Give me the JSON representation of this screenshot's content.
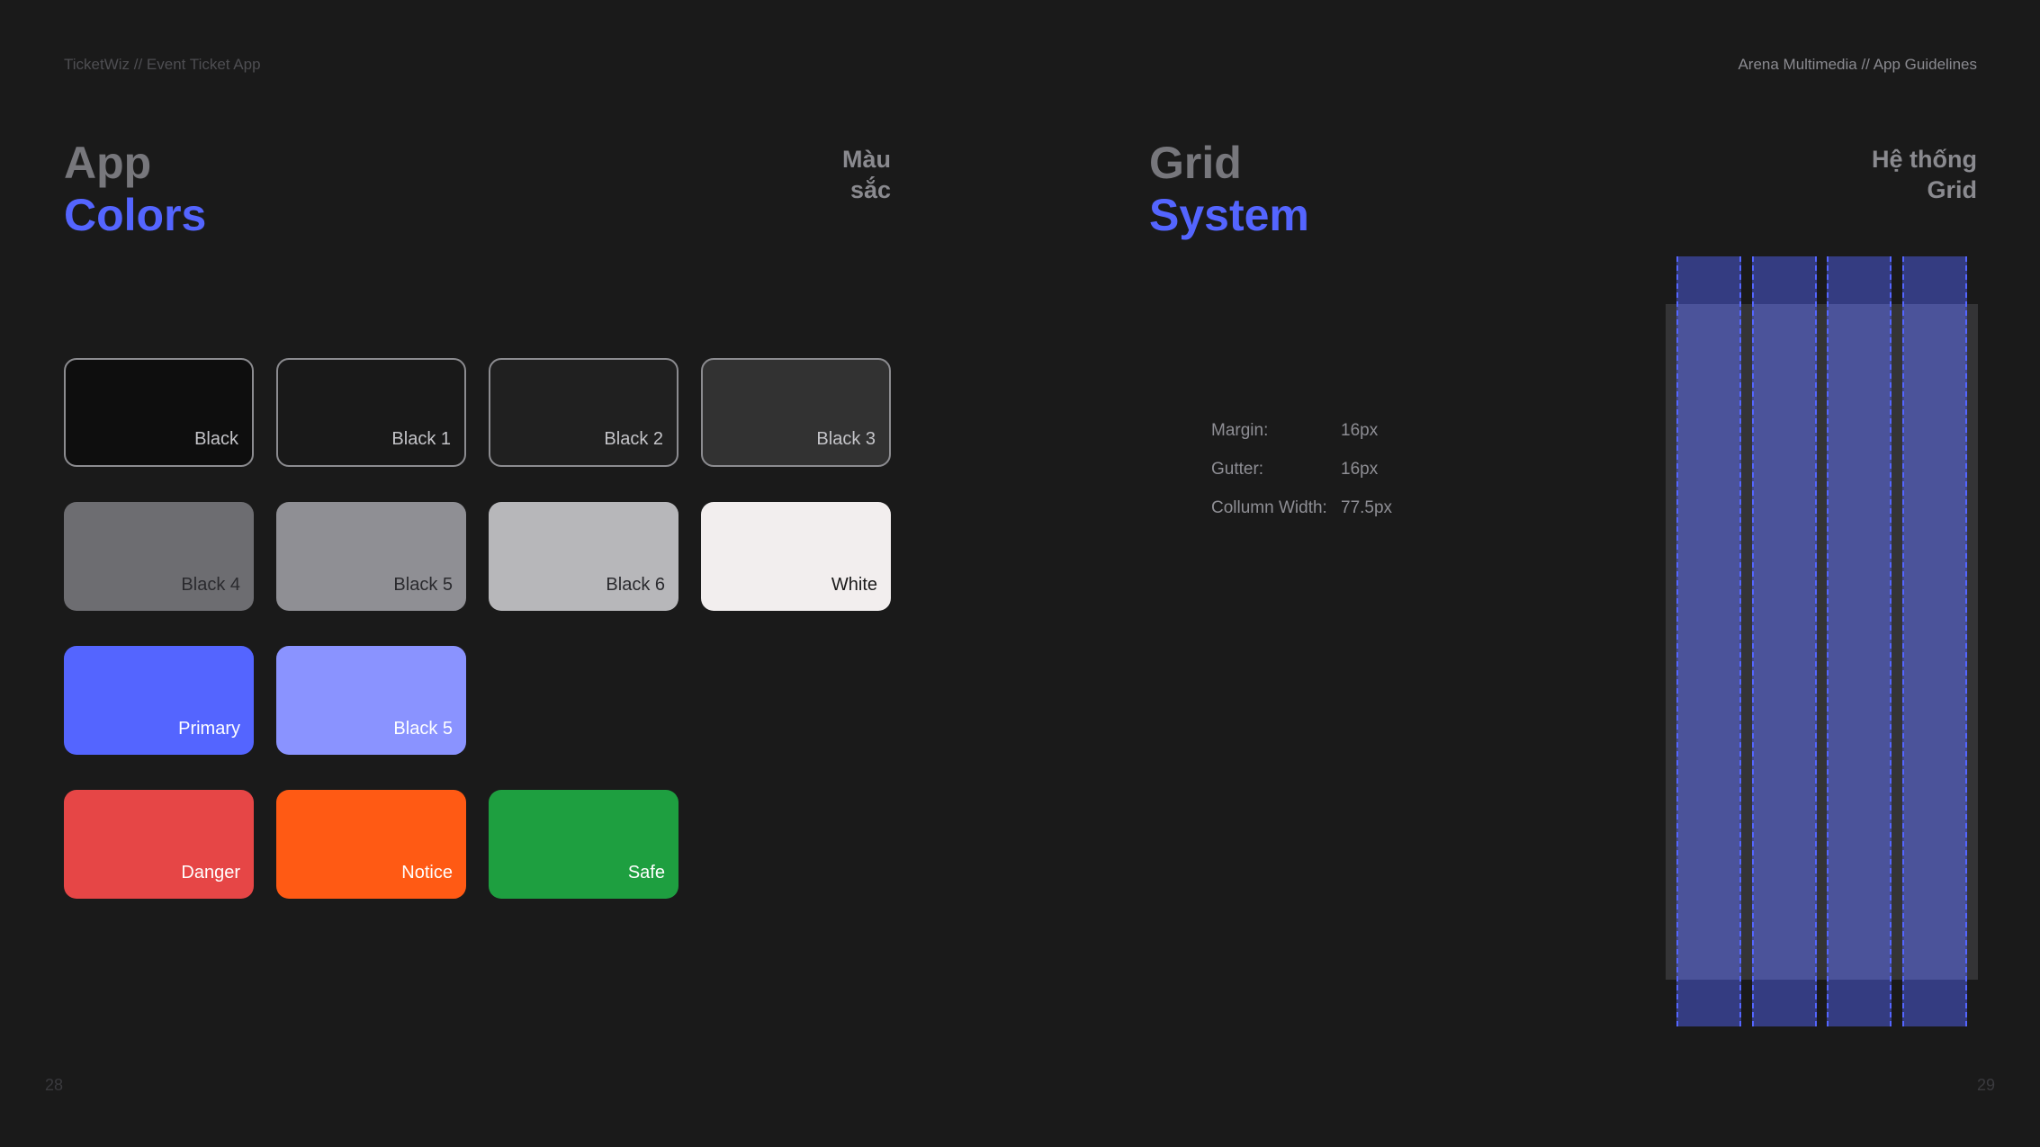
{
  "header": {
    "left": "TicketWiz // Event Ticket App",
    "right": "Arena Multimedia // App Guidelines"
  },
  "pages": {
    "left": "28",
    "right": "29"
  },
  "colors_section": {
    "title_line1": "App",
    "title_line2": "Colors",
    "subtitle_line1": "Màu",
    "subtitle_line2": "sắc",
    "swatches": [
      {
        "label": "Black",
        "color": "#0e0e0e"
      },
      {
        "label": "Black 1",
        "color": "#191919"
      },
      {
        "label": "Black 2",
        "color": "#202020"
      },
      {
        "label": "Black 3",
        "color": "#323232"
      },
      {
        "label": "Black 4",
        "color": "#6d6d71"
      },
      {
        "label": "Black 5",
        "color": "#8f8f94"
      },
      {
        "label": "Black 6",
        "color": "#b7b7ba"
      },
      {
        "label": "White",
        "color": "#f2eeee"
      },
      {
        "label": "Primary",
        "color": "#5465ff"
      },
      {
        "label": "Black 5",
        "color": "#8a93ff"
      },
      {
        "label": "Danger",
        "color": "#e64646"
      },
      {
        "label": "Notice",
        "color": "#ff5a14"
      },
      {
        "label": "Safe",
        "color": "#1e9f40"
      }
    ]
  },
  "grid_section": {
    "title_line1": "Grid",
    "title_line2": "System",
    "subtitle_line1": "Hệ thống",
    "subtitle_line2": "Grid",
    "specs": [
      {
        "key": "Margin:",
        "value": "16px"
      },
      {
        "key": "Gutter:",
        "value": "16px"
      },
      {
        "key": "Collumn Width:",
        "value": "77.5px"
      }
    ],
    "column_count": 4
  }
}
